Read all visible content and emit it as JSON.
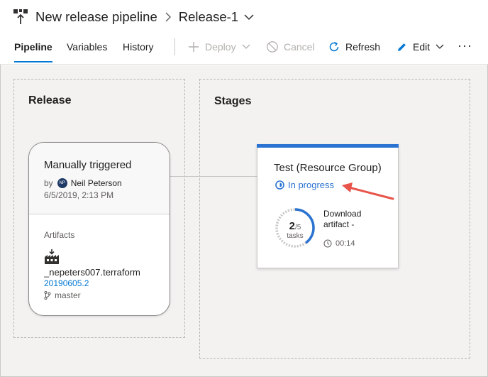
{
  "header": {
    "pipeline_name": "New release pipeline",
    "release_name": "Release-1"
  },
  "tabs": [
    {
      "label": "Pipeline",
      "active": true
    },
    {
      "label": "Variables",
      "active": false
    },
    {
      "label": "History",
      "active": false
    }
  ],
  "toolbar": {
    "deploy_label": "Deploy",
    "cancel_label": "Cancel",
    "refresh_label": "Refresh",
    "edit_label": "Edit",
    "more_label": "···"
  },
  "release_section": {
    "title": "Release",
    "trigger": "Manually triggered",
    "by_label": "by",
    "avatar_initials": "NP",
    "author": "Neil Peterson",
    "date": "6/5/2019, 2:13 PM",
    "artifacts_label": "Artifacts",
    "artifact_name": "_nepeters007.terraform",
    "artifact_version": "20190605.2",
    "branch": "master"
  },
  "stages_section": {
    "title": "Stages",
    "stage_name": "Test (Resource Group)",
    "status": "In progress",
    "tasks_done": "2",
    "tasks_total": "/5",
    "tasks_label": "tasks",
    "current_task": "Download artifact -",
    "elapsed": "00:14",
    "progress_fraction": 0.4
  },
  "colors": {
    "accent": "#2b73d1",
    "link": "#0078d4",
    "annotation_arrow": "#e8534a",
    "avatar": "#1f3a66"
  }
}
